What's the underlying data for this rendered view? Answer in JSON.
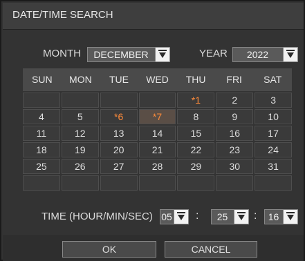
{
  "dialog": {
    "title": "DATE/TIME SEARCH"
  },
  "month": {
    "label": "MONTH",
    "value": "DECEMBER"
  },
  "year": {
    "label": "YEAR",
    "value": "2022"
  },
  "calendar": {
    "weekdays": [
      "SUN",
      "MON",
      "TUE",
      "WED",
      "THU",
      "FRI",
      "SAT"
    ],
    "weeks": [
      [
        "",
        "",
        "",
        "",
        "*1",
        "2",
        "3"
      ],
      [
        "4",
        "5",
        "*6",
        "*7",
        "8",
        "9",
        "10"
      ],
      [
        "11",
        "12",
        "13",
        "14",
        "15",
        "16",
        "17"
      ],
      [
        "18",
        "19",
        "20",
        "21",
        "22",
        "23",
        "24"
      ],
      [
        "25",
        "26",
        "27",
        "28",
        "29",
        "30",
        "31"
      ],
      [
        "",
        "",
        "",
        "",
        "",
        "",
        ""
      ]
    ],
    "marked_days": [
      "*1",
      "*6",
      "*7"
    ],
    "selected_day": "*7",
    "mark_color": "#ff8c3a"
  },
  "time": {
    "label": "TIME (HOUR/MIN/SEC)",
    "hour": "05",
    "minute": "25",
    "second": "16",
    "sep1": ":",
    "sep2": ":"
  },
  "buttons": {
    "ok": "OK",
    "cancel": "CANCEL"
  }
}
